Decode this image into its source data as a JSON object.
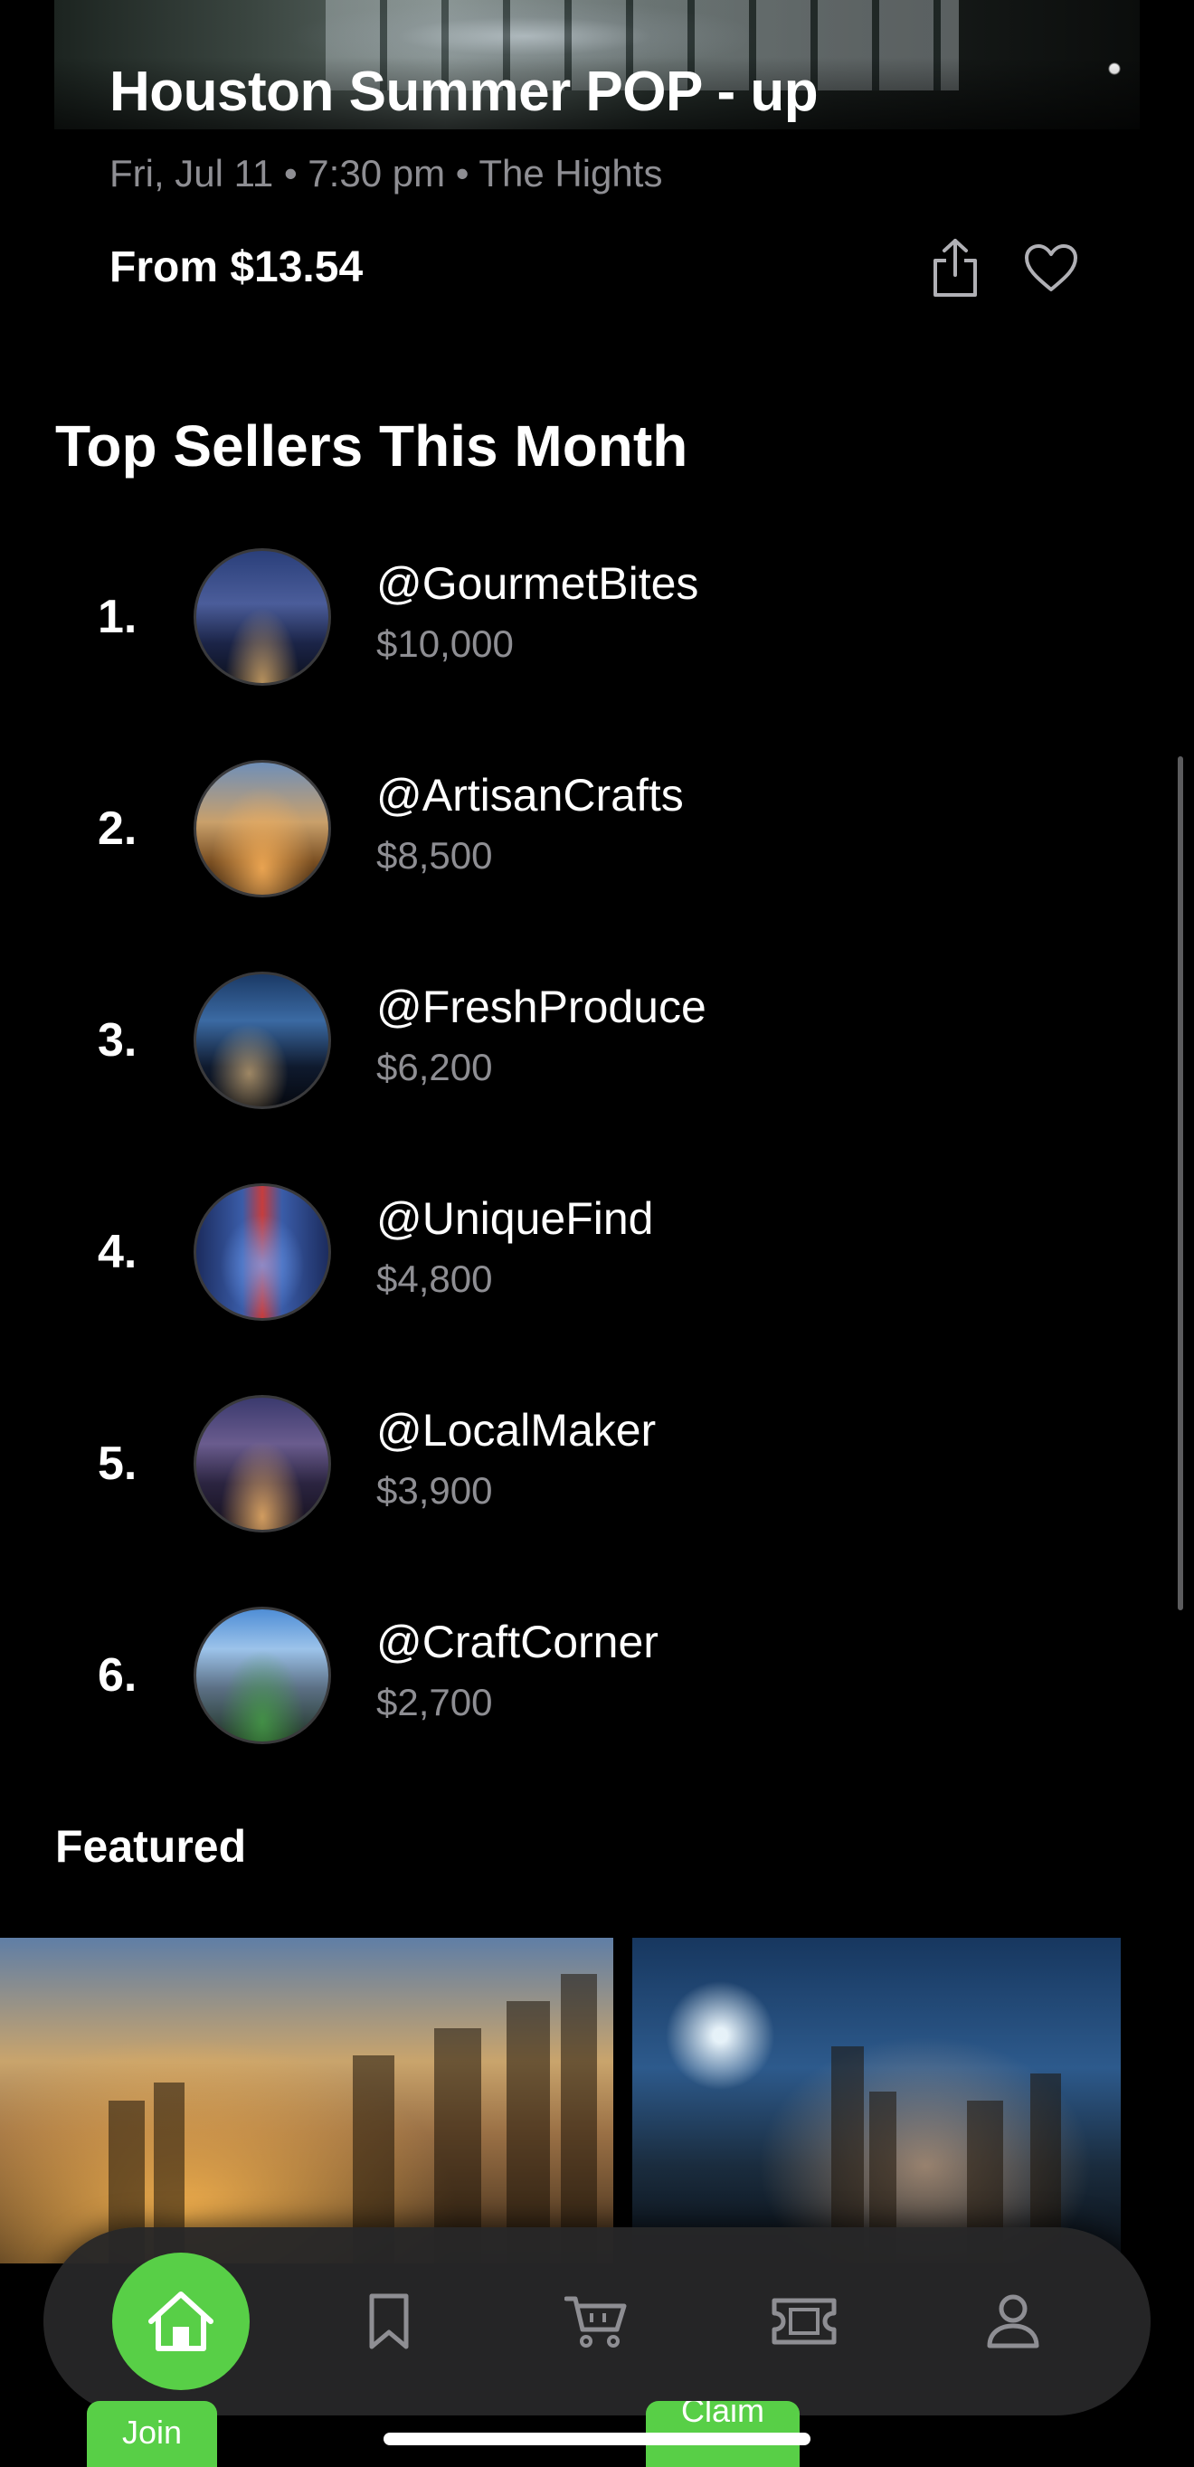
{
  "event": {
    "title": "Houston Summer POP - up",
    "meta": "Fri, Jul 11 • 7:30 pm • The Hights",
    "price": "From $13.54"
  },
  "top_sellers": {
    "title": "Top Sellers This Month",
    "items": [
      {
        "rank": "1.",
        "handle": "@GourmetBites",
        "amount": "$10,000"
      },
      {
        "rank": "2.",
        "handle": "@ArtisanCrafts",
        "amount": "$8,500"
      },
      {
        "rank": "3.",
        "handle": "@FreshProduce",
        "amount": "$6,200"
      },
      {
        "rank": "4.",
        "handle": "@UniqueFind",
        "amount": "$4,800"
      },
      {
        "rank": "5.",
        "handle": "@LocalMaker",
        "amount": "$3,900"
      },
      {
        "rank": "6.",
        "handle": "@CraftCorner",
        "amount": "$2,700"
      }
    ]
  },
  "featured": {
    "title": "Featured"
  },
  "tabbar": {
    "items": [
      {
        "name": "home",
        "icon": "home-icon",
        "active": true
      },
      {
        "name": "saved",
        "icon": "bookmark-icon",
        "active": false
      },
      {
        "name": "cart",
        "icon": "cart-icon",
        "active": false
      },
      {
        "name": "tickets",
        "icon": "ticket-icon",
        "active": false
      },
      {
        "name": "profile",
        "icon": "person-icon",
        "active": false
      }
    ]
  },
  "buttons": {
    "join": "Join",
    "claim": "Claim"
  },
  "colors": {
    "accent": "#58cf47",
    "background": "#000000",
    "secondary_text": "#8e8e93",
    "tabbar": "#262628"
  }
}
